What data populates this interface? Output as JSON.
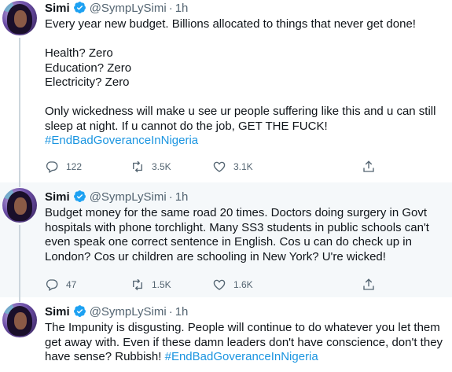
{
  "tweets": [
    {
      "name": "Simi",
      "handle": "@SympLySimi",
      "time": "1h",
      "lines": [
        "Every year new budget. Billions allocated to things that never get done!",
        "",
        "Health? Zero",
        "Education? Zero",
        "Electricity? Zero",
        "",
        "Only wickedness will make u see ur people suffering like this and u can still",
        "sleep at night. If u cannot do the job, GET THE FUCK!"
      ],
      "hashtag": "#EndBadGoveranceInNigeria",
      "replies": "122",
      "retweets": "3.5K",
      "likes": "3.1K"
    },
    {
      "name": "Simi",
      "handle": "@SympLySimi",
      "time": "1h",
      "lines": [
        "Budget money for the same road 20 times. Doctors doing surgery in Govt",
        "hospitals with phone torchlight. Many SS3 students in public schools can't",
        "even speak one correct sentence in English. Cos u can do check up in",
        "London? Cos ur children are schooling in New York? U're wicked!"
      ],
      "replies": "47",
      "retweets": "1.5K",
      "likes": "1.6K"
    },
    {
      "name": "Simi",
      "handle": "@SympLySimi",
      "time": "1h",
      "lines": [
        "The Impunity is disgusting. People will continue to do whatever you let them",
        "get away with. Even if these damn leaders don't have conscience, don't they"
      ],
      "last_line": "have sense? Rubbish!",
      "hashtag": "#EndBadGoveranceInNigeria"
    }
  ],
  "separator": "·",
  "icons": {
    "verified": "verified-badge-icon",
    "reply": "reply-icon",
    "retweet": "retweet-icon",
    "like": "heart-icon",
    "share": "share-icon"
  },
  "colors": {
    "text": "#0f1419",
    "secondary": "#536471",
    "link": "#1b95e0",
    "verified": "#1da1f2",
    "highlight_bg": "#f5f8fa"
  }
}
